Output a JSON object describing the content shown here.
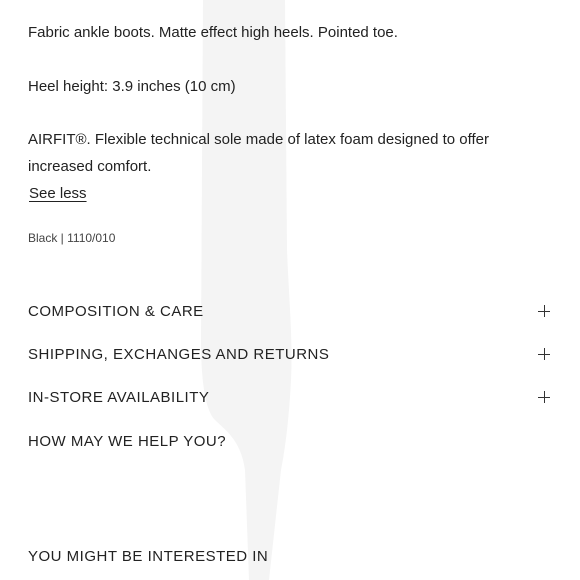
{
  "description": {
    "line1": "Fabric ankle boots. Matte effect high heels. Pointed toe.",
    "line2": "Heel height: 3.9 inches (10 cm)",
    "line3": "AIRFIT®. Flexible technical sole made of latex foam designed to offer increased comfort.",
    "see_less": "See less",
    "color_ref": "Black | 1110/010"
  },
  "accordion": [
    {
      "label": "COMPOSITION & CARE",
      "icon": "plus-icon"
    },
    {
      "label": "SHIPPING, EXCHANGES AND RETURNS",
      "icon": "plus-icon"
    },
    {
      "label": "IN-STORE AVAILABILITY",
      "icon": "plus-icon"
    },
    {
      "label": "HOW MAY WE HELP YOU?"
    }
  ],
  "recommendations": {
    "title": "YOU MIGHT BE INTERESTED IN"
  }
}
